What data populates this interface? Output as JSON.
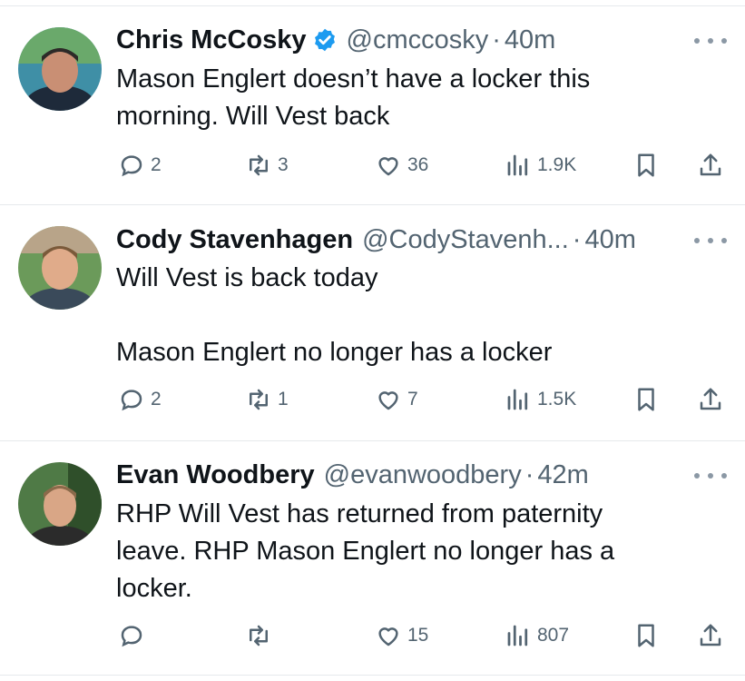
{
  "tweets": [
    {
      "name": "Chris McCosky",
      "verified": true,
      "handle": "@cmccosky",
      "time": "40m",
      "lines": [
        "Mason Englert doesn’t have a locker this",
        "morning. Will Vest back"
      ],
      "replies": "2",
      "retweets": "3",
      "likes": "36",
      "views": "1.9K"
    },
    {
      "name": "Cody Stavenhagen",
      "verified": false,
      "handle": "@CodyStavenh...",
      "time": "40m",
      "lines": [
        "Will Vest is back today",
        "",
        "Mason Englert no longer has a locker"
      ],
      "replies": "2",
      "retweets": "1",
      "likes": "7",
      "views": "1.5K"
    },
    {
      "name": "Evan Woodbery",
      "verified": false,
      "handle": "@evanwoodbery",
      "time": "42m",
      "lines": [
        "RHP Will Vest has returned from paternity",
        "leave. RHP Mason Englert no longer has a",
        "locker."
      ],
      "replies": "",
      "retweets": "",
      "likes": "15",
      "views": "807"
    }
  ],
  "colors": {
    "text": "#0f1419",
    "muted": "#536471",
    "verified": "#1d9bf0",
    "divider": "#e6e9ec"
  },
  "icons": [
    "reply-icon",
    "retweet-icon",
    "like-icon",
    "views-icon",
    "bookmark-icon",
    "share-icon",
    "more-icon",
    "verified-icon"
  ]
}
